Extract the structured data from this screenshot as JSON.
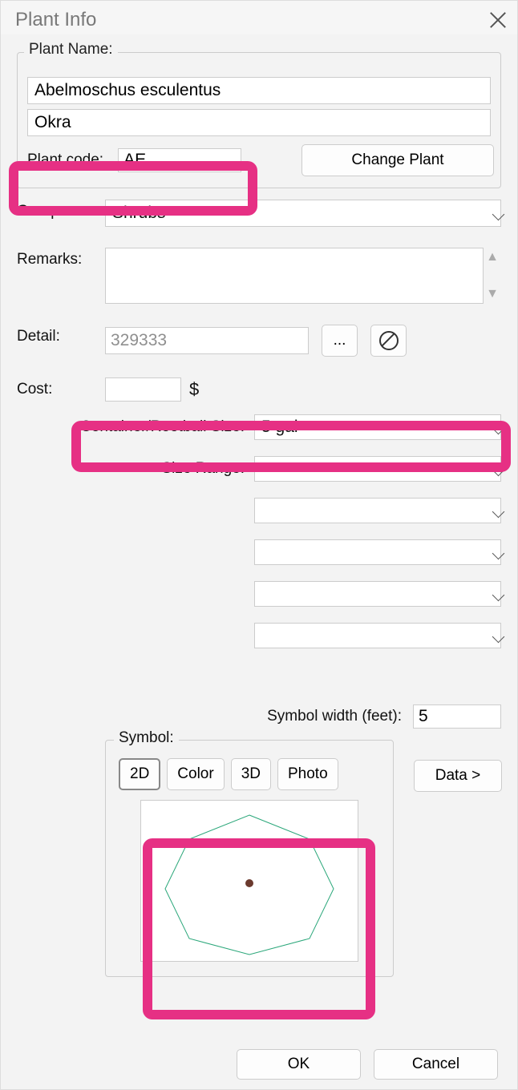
{
  "window": {
    "title": "Plant Info"
  },
  "plantName": {
    "legend": "Plant Name:",
    "scientific": "Abelmoschus esculentus",
    "common": "Okra",
    "codeLabel": "Plant code:",
    "code": "AE",
    "changePlantLabel": "Change Plant"
  },
  "group": {
    "label": "Group:",
    "value": "Shrubs"
  },
  "remarks": {
    "label": "Remarks:",
    "value": ""
  },
  "detail": {
    "label": "Detail:",
    "value": "329333",
    "browseLabel": "...",
    "clearIcon": "prohibit"
  },
  "cost": {
    "label": "Cost:",
    "value": "",
    "currency": "$"
  },
  "container": {
    "label": "Container/Rootball Size:",
    "value": "5 gal"
  },
  "sizeRange": {
    "label": "Size Range:",
    "value": ""
  },
  "extraSelects": [
    {
      "value": ""
    },
    {
      "value": ""
    },
    {
      "value": ""
    },
    {
      "value": ""
    }
  ],
  "symbolWidth": {
    "label": "Symbol width (feet):",
    "value": "5"
  },
  "symbol": {
    "legend": "Symbol:",
    "tabs": {
      "twoD": "2D",
      "color": "Color",
      "threeD": "3D",
      "photo": "Photo"
    },
    "dataLabel": "Data >"
  },
  "buttons": {
    "ok": "OK",
    "cancel": "Cancel"
  }
}
